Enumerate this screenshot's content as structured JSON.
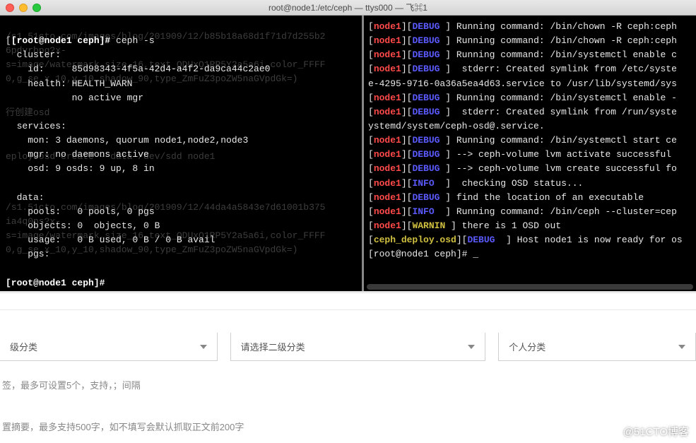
{
  "titlebar": {
    "title": "root@node1:/etc/ceph — ttys000 — 飞⌘1"
  },
  "left_terminal": {
    "prompt1": "[root@node1 ceph]# ",
    "cmd1": "ceph -s",
    "l1": "  cluster:",
    "l2": "    id:     85d98343-4f5a-42d4-a4f2-da9ca44c2ae0",
    "l3": "    health: HEALTH_WARN",
    "l4": "            no active mgr",
    "l5": " ",
    "l6": "  services:",
    "l7": "    mon: 3 daemons, quorum node1,node2,node3",
    "l8": "    mgr: no daemons active",
    "l9": "    osd: 9 osds: 9 up, 8 in",
    "l10": " ",
    "l11": "  data:",
    "l12": "    pools:   0 pools, 0 pgs",
    "l13": "    objects: 0  objects, 0 B",
    "l14": "    usage:   0 B used, 0 B / 0 B avail",
    "l15": "    pgs:     ",
    "l16": " ",
    "prompt2": "[root@node1 ceph]# ",
    "ghost1": "/s1.51cto.com/images/blog/201909/12/b85b18a68d1f71d7d255b2",
    "ghost2": "6pdyrbpg?x-",
    "ghost3": "s=image/watermark,size_16,text_QDUxQ1RP5Y2a5a6i,color_FFFF",
    "ghost4": "0,g_se,x_10,y_10,shadow_90,type_ZmFuZ3poZW5naGVpdGk=)",
    "ghost5": "行创建osd",
    "ghost6": "eploy osd create --data /dev/sdd node1",
    "ghost7": "/s1.51cto.com/images/blog/201909/12/44da4a5843e7d61001b375",
    "ghost8": "ia4q0ps?x-",
    "ghost9": "s=image/watermark,size_16,text_QDUxQ1RP5Y2a5a6i,color_FFFF",
    "ghost10": "0,g_se,x_10,y_10,shadow_90,type_ZmFuZ3poZW5naGVpdGk=)"
  },
  "right_terminal": {
    "lines": [
      {
        "host": "node1",
        "lvl": "DEBUG",
        "lvlc": "blue",
        "txt": "] Running command: /bin/chown -R ceph:ceph"
      },
      {
        "host": "node1",
        "lvl": "DEBUG",
        "lvlc": "blue",
        "txt": "] Running command: /bin/chown -R ceph:ceph"
      },
      {
        "host": "node1",
        "lvl": "DEBUG",
        "lvlc": "blue",
        "txt": "] Running command: /bin/systemctl enable c"
      },
      {
        "host": "node1",
        "lvl": "DEBUG",
        "lvlc": "blue",
        "txt": "]  stderr: Created symlink from /etc/syste"
      },
      {
        "cont": "e-4295-9716-0a36a5ea4d63.service to /usr/lib/systemd/sys"
      },
      {
        "host": "node1",
        "lvl": "DEBUG",
        "lvlc": "blue",
        "txt": "] Running command: /bin/systemctl enable -"
      },
      {
        "host": "node1",
        "lvl": "DEBUG",
        "lvlc": "blue",
        "txt": "]  stderr: Created symlink from /run/syste"
      },
      {
        "cont": "ystemd/system/ceph-osd@.service."
      },
      {
        "host": "node1",
        "lvl": "DEBUG",
        "lvlc": "blue",
        "txt": "] Running command: /bin/systemctl start ce"
      },
      {
        "host": "node1",
        "lvl": "DEBUG",
        "lvlc": "blue",
        "txt": "] --> ceph-volume lvm activate successful "
      },
      {
        "host": "node1",
        "lvl": "DEBUG",
        "lvlc": "blue",
        "txt": "] --> ceph-volume lvm create successful fo"
      },
      {
        "host": "node1",
        "lvl": "INFO",
        "lvlc": "blue",
        "txt": " ]  checking OSD status..."
      },
      {
        "host": "node1",
        "lvl": "DEBUG",
        "lvlc": "blue",
        "txt": "] find the location of an executable"
      },
      {
        "host": "node1",
        "lvl": "INFO",
        "lvlc": "blue",
        "txt": " ] Running command: /bin/ceph --cluster=cep"
      },
      {
        "host": "node1",
        "lvl": "WARNIN",
        "lvlc": "yellow",
        "txt": "] there is 1 OSD out"
      },
      {
        "host": "ceph_deploy.osd",
        "hostc": "yellow",
        "lvl": "DEBUG",
        "lvlc": "blue",
        "txt": " ] Host node1 is now ready for os"
      }
    ],
    "prompt": "[root@node1 ceph]# ",
    "cursor": "_"
  },
  "dropdowns": {
    "d1": "级分类",
    "d2": "请选择二级分类",
    "d3": "个人分类"
  },
  "hints": {
    "h1": "签，最多可设置5个，支持，；间隔",
    "h2": "置摘要，最多支持500字，如不填写会默认抓取正文前200字"
  },
  "watermark": "@51CTO博客"
}
